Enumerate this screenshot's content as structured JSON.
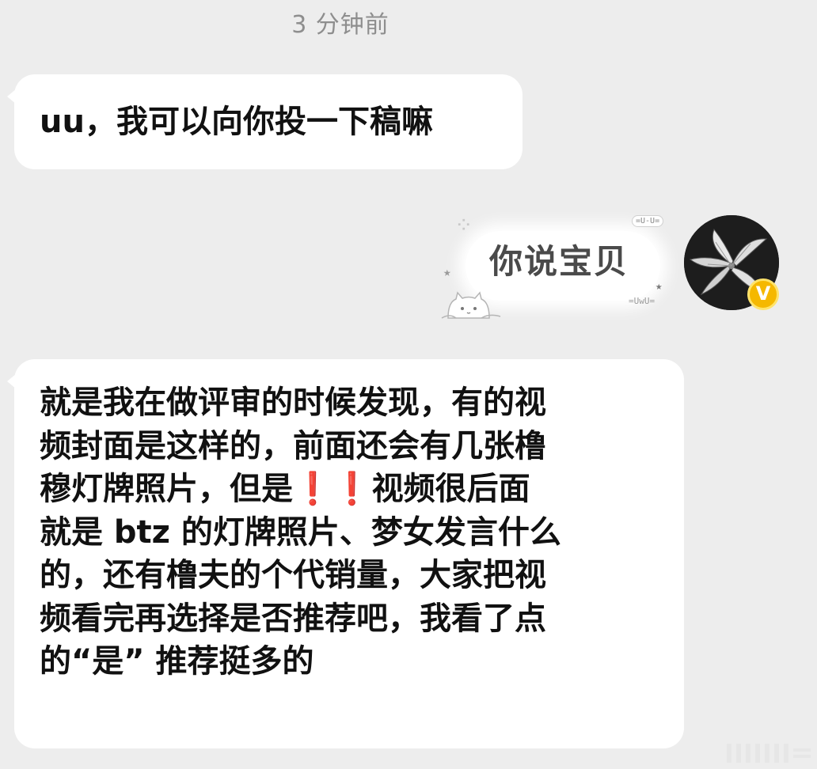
{
  "chat": {
    "timestamp": "3 分钟前",
    "messages": [
      {
        "sender": "other",
        "text": "uu，我可以向你投一下稿嘛"
      },
      {
        "sender": "self",
        "text": "你说宝贝",
        "sticker_labels": {
          "top": "=U-U=",
          "bottom": "=UwU="
        }
      },
      {
        "sender": "other",
        "lines": [
          "就是我在做评审的时候发现，有的视",
          "频封面是这样的，前面还会有几张橹",
          "穆灯牌照片，但是",
          "视频很后面",
          "就是 btz 的灯牌照片、梦女发言什么",
          "的，还有橹夫的个代销量，大家把视",
          "频看完再选择是否推荐吧，我看了点",
          "的“是” 推荐挺多的"
        ],
        "exclamation_marks": [
          "❗",
          "❗"
        ]
      }
    ]
  },
  "avatar": {
    "badge": "V",
    "badge_color": "#f5b800"
  },
  "colors": {
    "background": "#ededed",
    "bubble": "#ffffff",
    "accent_red": "#e0192a"
  }
}
